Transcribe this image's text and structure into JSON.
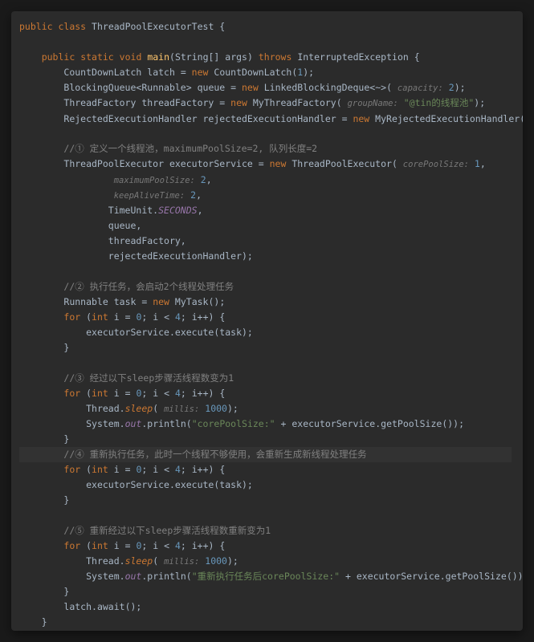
{
  "kw": {
    "public": "public",
    "class": "class",
    "static": "static",
    "void": "void",
    "throws": "throws",
    "new": "new",
    "int": "int",
    "for": "for"
  },
  "cls": {
    "name": "ThreadPoolExecutorTest"
  },
  "main": {
    "name": "main",
    "argType": "String[]",
    "argName": "args",
    "throws": "InterruptedException"
  },
  "l1": {
    "type": "CountDownLatch",
    "var": "latch",
    "ctor": "CountDownLatch",
    "arg": "1"
  },
  "l2": {
    "type1": "BlockingQueue",
    "gen": "Runnable",
    "var": "queue",
    "ctor": "LinkedBlockingDeque",
    "diamond": "<~>",
    "hint": "capacity:",
    "arg": "2"
  },
  "l3": {
    "type": "ThreadFactory",
    "var": "threadFactory",
    "ctor": "MyThreadFactory",
    "hint": "groupName:",
    "arg": "\"@tin的线程池\""
  },
  "l4": {
    "type": "RejectedExecutionHandler",
    "var": "rejectedExecutionHandler",
    "ctor": "MyRejectedExecutionHandler"
  },
  "c1": "//① 定义一个线程池，maximumPoolSize=2, 队列长度=2",
  "ex": {
    "type": "ThreadPoolExecutor",
    "var": "executorService",
    "ctor": "ThreadPoolExecutor",
    "h1": "corePoolSize:",
    "v1": "1",
    "h2": "maximumPoolSize:",
    "v2": "2",
    "h3": "keepAliveTime:",
    "v3": "2",
    "tu": "TimeUnit",
    "sec": "SECONDS",
    "a5": "queue",
    "a6": "threadFactory",
    "a7": "rejectedExecutionHandler"
  },
  "c2": "//② 执行任务，会启动2个线程处理任务",
  "task": {
    "type": "Runnable",
    "var": "task",
    "ctor": "MyTask"
  },
  "for1": {
    "init": "i = ",
    "z": "0",
    "cond": "i < ",
    "lim": "4",
    "inc": "i++"
  },
  "exec": {
    "obj": "executorService",
    "m": "execute",
    "arg": "task"
  },
  "c3": "//③ 经过以下sleep步骤活线程数变为1",
  "sleep": {
    "obj": "Thread",
    "m": "sleep",
    "hint": "millis:",
    "arg": "1000"
  },
  "print": {
    "sys": "System",
    "out": "out",
    "m": "println",
    "s1": "\"corePoolSize:\"",
    "plus": " + ",
    "o": "executorService",
    "g": "getPoolSize"
  },
  "c4": "//④ 重新执行任务，此时一个线程不够使用，会重新生成新线程处理任务",
  "c5": "//⑤ 重新经过以下sleep步骤活线程数重新变为1",
  "print2": {
    "s1": "\"重新执行任务后corePoolSize:\""
  },
  "await": {
    "obj": "latch",
    "m": "await"
  }
}
